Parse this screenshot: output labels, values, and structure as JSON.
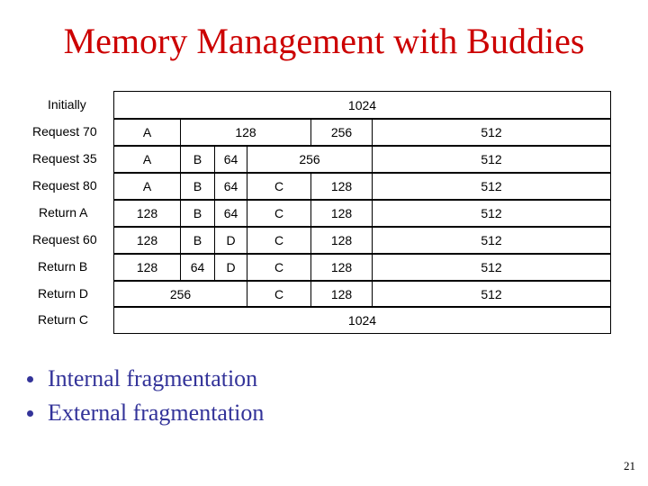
{
  "slide": {
    "title": "Memory Management with Buddies",
    "page_number": "21"
  },
  "table": {
    "rows": [
      {
        "label": "Initially",
        "cells": [
          "1024"
        ]
      },
      {
        "label": "Request 70",
        "cells": [
          "A",
          "128",
          "256",
          "512"
        ]
      },
      {
        "label": "Request 35",
        "cells": [
          "A",
          "B",
          "64",
          "256",
          "512"
        ]
      },
      {
        "label": "Request 80",
        "cells": [
          "A",
          "B",
          "64",
          "C",
          "128",
          "512"
        ]
      },
      {
        "label": "Return A",
        "cells": [
          "128",
          "B",
          "64",
          "C",
          "128",
          "512"
        ]
      },
      {
        "label": "Request 60",
        "cells": [
          "128",
          "B",
          "D",
          "C",
          "128",
          "512"
        ]
      },
      {
        "label": "Return B",
        "cells": [
          "128",
          "64",
          "D",
          "C",
          "128",
          "512"
        ]
      },
      {
        "label": "Return D",
        "cells": [
          "256",
          "C",
          "128",
          "512"
        ]
      },
      {
        "label": "Return C",
        "cells": [
          "1024"
        ]
      }
    ]
  },
  "bullets": [
    "Internal fragmentation",
    "External fragmentation"
  ],
  "colors": {
    "title": "#cc0000",
    "bullets": "#333399"
  }
}
